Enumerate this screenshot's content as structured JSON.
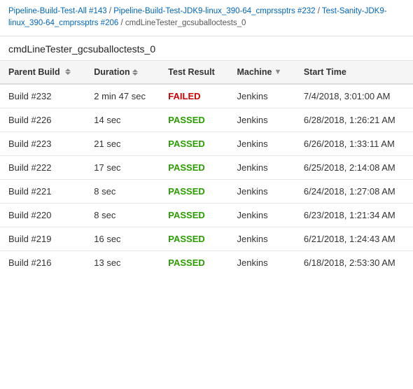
{
  "breadcrumb": {
    "items": [
      {
        "label": "Pipeline-Build-Test-All #143",
        "link": true
      },
      {
        "label": "Pipeline-Build-Test-JDK9-linux_390-64_cmprssptrs #232",
        "link": true
      },
      {
        "label": "Test-Sanity-JDK9-linux_390-64_cmprssptrs #206",
        "link": true
      },
      {
        "label": "cmdLineTester_gcsuballoctests_0",
        "link": false
      }
    ]
  },
  "page_title": "cmdLineTester_gcsuballoctests_0",
  "table": {
    "columns": [
      {
        "key": "parent_build",
        "label": "Parent Build",
        "sortable": true,
        "filterable": false
      },
      {
        "key": "duration",
        "label": "Duration",
        "sortable": true,
        "filterable": false
      },
      {
        "key": "test_result",
        "label": "Test Result",
        "sortable": false,
        "filterable": false
      },
      {
        "key": "machine",
        "label": "Machine",
        "sortable": false,
        "filterable": true
      },
      {
        "key": "start_time",
        "label": "Start Time",
        "sortable": false,
        "filterable": false
      }
    ],
    "rows": [
      {
        "parent_build": "Build #232",
        "duration": "2 min 47 sec",
        "test_result": "FAILED",
        "status": "failed",
        "machine": "Jenkins",
        "start_time": "7/4/2018, 3:01:00 AM"
      },
      {
        "parent_build": "Build #226",
        "duration": "14 sec",
        "test_result": "PASSED",
        "status": "passed",
        "machine": "Jenkins",
        "start_time": "6/28/2018, 1:26:21 AM"
      },
      {
        "parent_build": "Build #223",
        "duration": "21 sec",
        "test_result": "PASSED",
        "status": "passed",
        "machine": "Jenkins",
        "start_time": "6/26/2018, 1:33:11 AM"
      },
      {
        "parent_build": "Build #222",
        "duration": "17 sec",
        "test_result": "PASSED",
        "status": "passed",
        "machine": "Jenkins",
        "start_time": "6/25/2018, 2:14:08 AM"
      },
      {
        "parent_build": "Build #221",
        "duration": "8 sec",
        "test_result": "PASSED",
        "status": "passed",
        "machine": "Jenkins",
        "start_time": "6/24/2018, 1:27:08 AM"
      },
      {
        "parent_build": "Build #220",
        "duration": "8 sec",
        "test_result": "PASSED",
        "status": "passed",
        "machine": "Jenkins",
        "start_time": "6/23/2018, 1:21:34 AM"
      },
      {
        "parent_build": "Build #219",
        "duration": "16 sec",
        "test_result": "PASSED",
        "status": "passed",
        "machine": "Jenkins",
        "start_time": "6/21/2018, 1:24:43 AM"
      },
      {
        "parent_build": "Build #216",
        "duration": "13 sec",
        "test_result": "PASSED",
        "status": "passed",
        "machine": "Jenkins",
        "start_time": "6/18/2018, 2:53:30 AM"
      }
    ]
  }
}
